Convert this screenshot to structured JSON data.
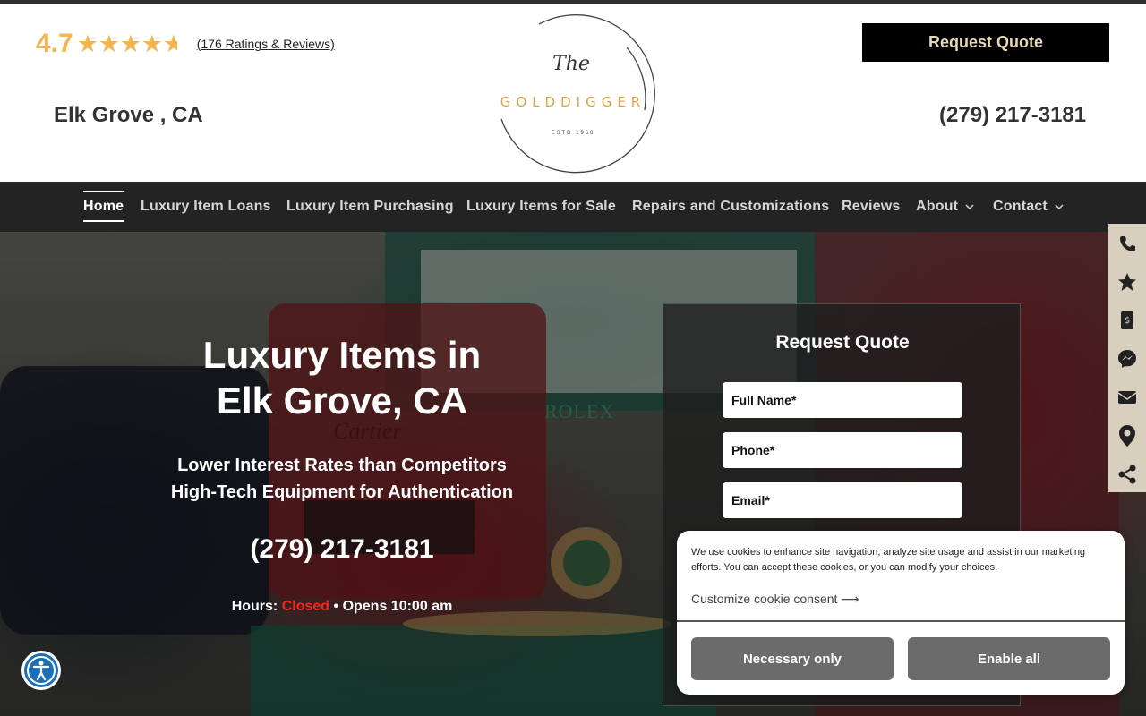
{
  "header": {
    "rating_value": "4.7",
    "rating_stars": 4.7,
    "rating_link": "(176 Ratings & Reviews)",
    "city": "Elk Grove , CA",
    "logo_the": "The",
    "logo_name": "GOLDDIGGER",
    "logo_estd": "ESTD 1968",
    "request_quote": "Request Quote",
    "phone": "(279) 217-3181"
  },
  "nav": {
    "items": [
      {
        "label": "Home",
        "active": true
      },
      {
        "label": "Luxury Item Loans"
      },
      {
        "label": "Luxury Item Purchasing"
      },
      {
        "label": "Luxury Items for Sale"
      },
      {
        "label": "Repairs and Customizations"
      },
      {
        "label": "Reviews"
      },
      {
        "label": "About",
        "dropdown": true
      },
      {
        "label": "Contact",
        "dropdown": true
      }
    ]
  },
  "hero": {
    "title_line1": "Luxury Items in",
    "title_line2": "Elk Grove, CA",
    "sub_line1": "Lower Interest Rates than Competitors",
    "sub_line2": "High-Tech Equipment for Authentication",
    "phone": "(279) 217-3181",
    "hours_label": "Hours:",
    "hours_status": "Closed",
    "hours_next": "• Opens 10:00 am",
    "rolex_brand": "ROLEX",
    "cartier_brand": "Cartier"
  },
  "quote_form": {
    "title": "Request Quote",
    "full_name_placeholder": "Full Name*",
    "phone_placeholder": "Phone*",
    "email_placeholder": "Email*"
  },
  "side_dock": {
    "items": [
      "phone-icon",
      "star-icon",
      "payment-icon",
      "messenger-icon",
      "email-icon",
      "location-icon",
      "share-icon"
    ]
  },
  "cookie": {
    "text": "We use cookies to enhance site navigation, analyze site usage and assist in our marketing efforts. You can accept these cookies, or you can modify your choices.",
    "customize": "Customize cookie consent",
    "necessary_only": "Necessary only",
    "enable_all": "Enable all"
  },
  "colors": {
    "gold": "#f4b450",
    "nav_bg": "#232323",
    "dock_bg": "#d8cfbf",
    "closed_red": "#ff2020",
    "accessibility_blue": "#1a6fb5"
  }
}
